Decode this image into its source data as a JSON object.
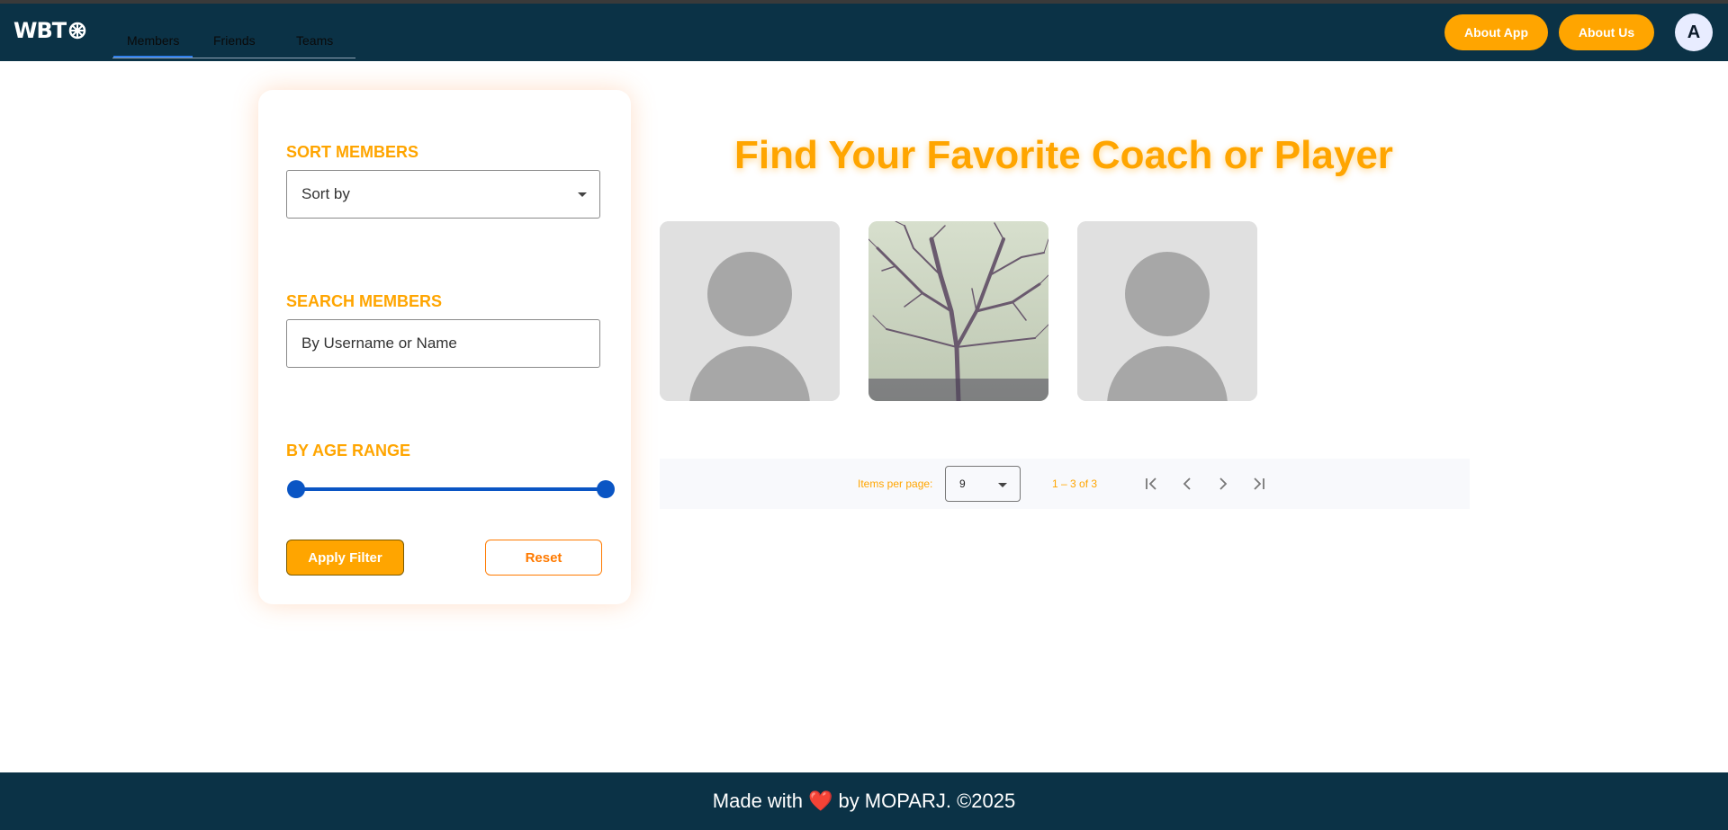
{
  "brand": {
    "name": "WBT"
  },
  "nav": {
    "tabs": [
      {
        "label": "Members",
        "active": true
      },
      {
        "label": "Friends",
        "active": false
      },
      {
        "label": "Teams",
        "active": false
      }
    ],
    "about_app": "About App",
    "about_us": "About Us",
    "avatar_initial": "A"
  },
  "filters": {
    "sort_title": "SORT MEMBERS",
    "sort_placeholder": "Sort by",
    "search_title": "SEARCH MEMBERS",
    "search_placeholder": "By Username or Name",
    "age_title": "BY AGE RANGE",
    "age_range_fraction": [
      0,
      1
    ],
    "apply_label": "Apply Filter",
    "reset_label": "Reset"
  },
  "main": {
    "heading": "Find Your Favorite Coach or Player",
    "members": [
      {
        "photo": "default-avatar"
      },
      {
        "photo": "tree-photo"
      },
      {
        "photo": "default-avatar"
      }
    ]
  },
  "paginator": {
    "items_per_page_label": "Items per page:",
    "items_per_page_value": "9",
    "range_label": "1 – 3 of 3"
  },
  "footer": {
    "made_with": "Made with",
    "heart": "❤️",
    "by_text": "by MOPARJ. ©2025"
  },
  "colors": {
    "navbar": "#0b3246",
    "accent": "#ffa500",
    "reset_text": "#ff7a00",
    "slider": "#0a55c4"
  }
}
